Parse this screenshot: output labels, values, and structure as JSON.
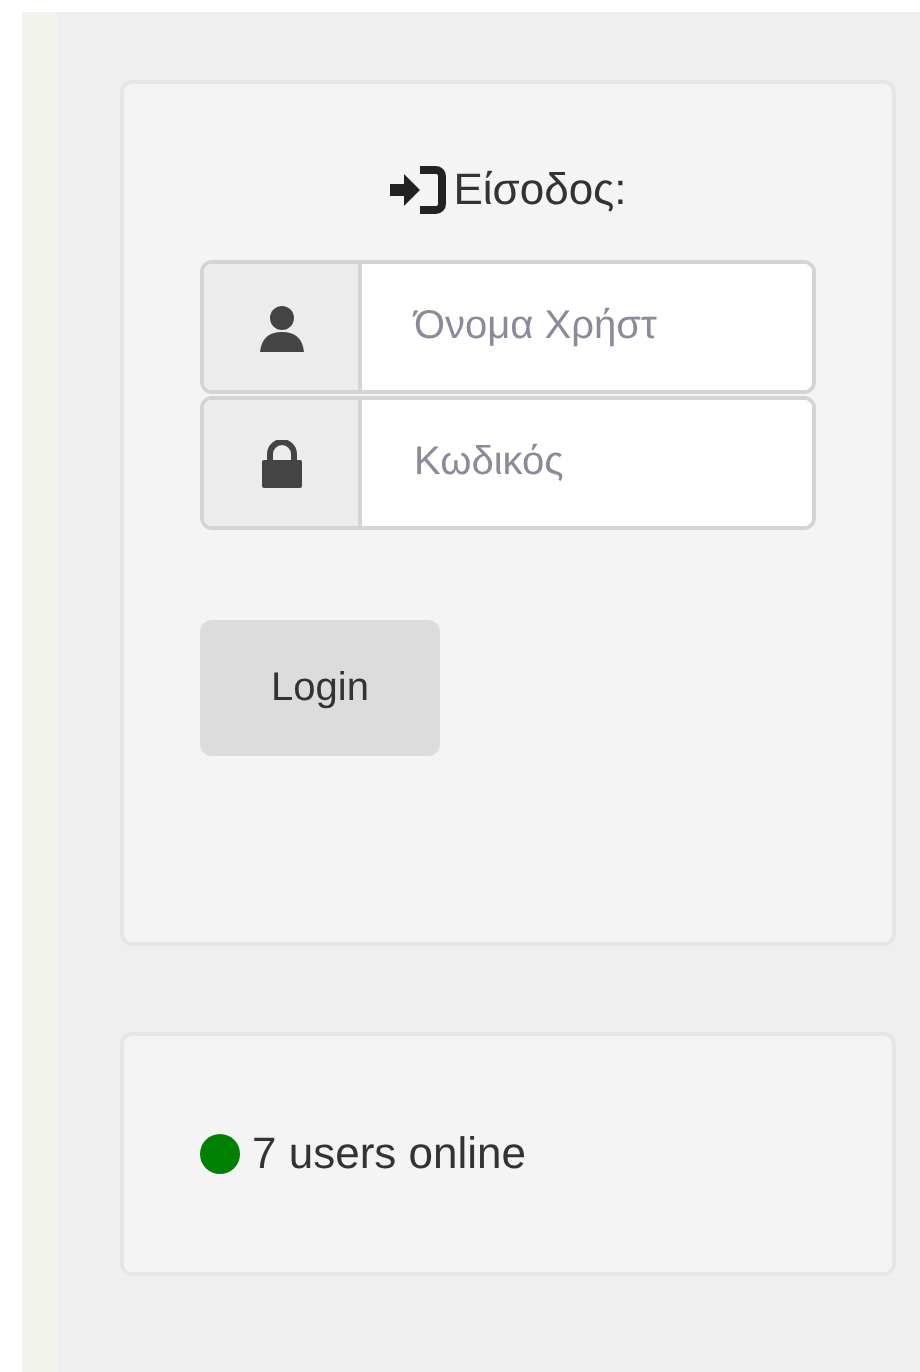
{
  "login": {
    "title": "Είσοδος:",
    "fields": [
      {
        "kind": "user",
        "placeholder": "Όνομα Χρήστ"
      },
      {
        "kind": "password",
        "placeholder": "Κωδικός"
      }
    ],
    "button": "Login"
  },
  "online": {
    "text": "7 users online",
    "color": "#008000"
  }
}
